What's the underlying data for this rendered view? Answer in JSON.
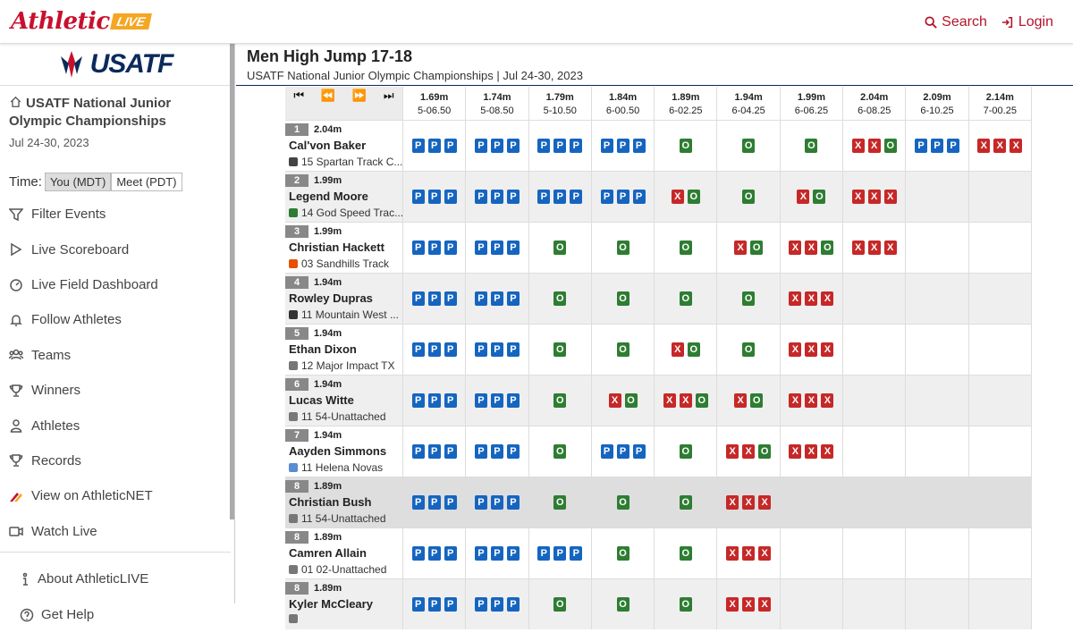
{
  "brand": {
    "logo_main": "Athletic",
    "logo_badge": "LIVE"
  },
  "topnav": {
    "search": "Search",
    "login": "Login"
  },
  "sidebar": {
    "org_logo": "USATF",
    "meet_title": "USATF National Junior Olympic Championships",
    "meet_dates": "Jul 24-30, 2023",
    "time_label": "Time:",
    "time_you": "You (MDT)",
    "time_meet": "Meet (PDT)",
    "items": [
      {
        "label": "Filter Events",
        "icon": "filter-icon"
      },
      {
        "label": "Live Scoreboard",
        "icon": "play-icon"
      },
      {
        "label": "Live Field Dashboard",
        "icon": "gauge-icon"
      },
      {
        "label": "Follow Athletes",
        "icon": "bell-icon"
      },
      {
        "label": "Teams",
        "icon": "users-icon"
      },
      {
        "label": "Winners",
        "icon": "trophy-icon"
      },
      {
        "label": "Athletes",
        "icon": "user-icon"
      },
      {
        "label": "Records",
        "icon": "trophy-icon"
      },
      {
        "label": "View on AthleticNET",
        "icon": "athleticnet-icon"
      },
      {
        "label": "Watch Live",
        "icon": "video-icon"
      }
    ],
    "footer_items": [
      {
        "label": "About AthleticLIVE",
        "icon": "info-icon"
      },
      {
        "label": "Get Help",
        "icon": "help-icon"
      }
    ]
  },
  "event": {
    "title": "Men High Jump 17-18",
    "subtitle": "USATF National Junior Olympic Championships | Jul 24-30, 2023"
  },
  "heights": [
    {
      "m": "1.69m",
      "ft": "5-06.50"
    },
    {
      "m": "1.74m",
      "ft": "5-08.50"
    },
    {
      "m": "1.79m",
      "ft": "5-10.50"
    },
    {
      "m": "1.84m",
      "ft": "6-00.50"
    },
    {
      "m": "1.89m",
      "ft": "6-02.25"
    },
    {
      "m": "1.94m",
      "ft": "6-04.25"
    },
    {
      "m": "1.99m",
      "ft": "6-06.25"
    },
    {
      "m": "2.04m",
      "ft": "6-08.25"
    },
    {
      "m": "2.09m",
      "ft": "6-10.25"
    },
    {
      "m": "2.14m",
      "ft": "7-00.25"
    }
  ],
  "athletes": [
    {
      "place": "1",
      "best": "2.04m",
      "name": "Cal'von Baker",
      "team": "15 Spartan Track C...",
      "team_color": "#444",
      "attempts": [
        "PPP",
        "PPP",
        "PPP",
        "PPP",
        "O",
        "O",
        "O",
        "XXO",
        "PPP",
        "XXX"
      ]
    },
    {
      "place": "2",
      "best": "1.99m",
      "name": "Legend Moore",
      "team": "14 God Speed Trac...",
      "team_color": "#2e7d32",
      "attempts": [
        "PPP",
        "PPP",
        "PPP",
        "PPP",
        "XO",
        "O",
        "XO",
        "XXX",
        "",
        ""
      ]
    },
    {
      "place": "3",
      "best": "1.99m",
      "name": "Christian Hackett",
      "team": "03 Sandhills Track",
      "team_color": "#e65100",
      "attempts": [
        "PPP",
        "PPP",
        "O",
        "O",
        "O",
        "XO",
        "XXO",
        "XXX",
        "",
        ""
      ]
    },
    {
      "place": "4",
      "best": "1.94m",
      "name": "Rowley Dupras",
      "team": "11 Mountain West ...",
      "team_color": "#333",
      "attempts": [
        "PPP",
        "PPP",
        "O",
        "O",
        "O",
        "O",
        "XXX",
        "",
        "",
        ""
      ]
    },
    {
      "place": "5",
      "best": "1.94m",
      "name": "Ethan Dixon",
      "team": "12 Major Impact TX",
      "team_color": "#777",
      "attempts": [
        "PPP",
        "PPP",
        "O",
        "O",
        "XO",
        "O",
        "XXX",
        "",
        "",
        ""
      ]
    },
    {
      "place": "6",
      "best": "1.94m",
      "name": "Lucas Witte",
      "team": "11 54-Unattached",
      "team_color": "#777",
      "attempts": [
        "PPP",
        "PPP",
        "O",
        "XO",
        "XXO",
        "XO",
        "XXX",
        "",
        "",
        ""
      ]
    },
    {
      "place": "7",
      "best": "1.94m",
      "name": "Aayden Simmons",
      "team": "11 Helena Novas",
      "team_color": "#5b8bd0",
      "attempts": [
        "PPP",
        "PPP",
        "O",
        "PPP",
        "O",
        "XXO",
        "XXX",
        "",
        "",
        ""
      ]
    },
    {
      "place": "8",
      "best": "1.89m",
      "name": "Christian Bush",
      "team": "11 54-Unattached",
      "team_color": "#777",
      "attempts": [
        "PPP",
        "PPP",
        "O",
        "O",
        "O",
        "XXX",
        "",
        "",
        "",
        ""
      ]
    },
    {
      "place": "8",
      "best": "1.89m",
      "name": "Camren Allain",
      "team": "01 02-Unattached",
      "team_color": "#777",
      "attempts": [
        "PPP",
        "PPP",
        "PPP",
        "O",
        "O",
        "XXX",
        "",
        "",
        "",
        ""
      ]
    },
    {
      "place": "8",
      "best": "1.89m",
      "name": "Kyler McCleary",
      "team": "",
      "team_color": "#777",
      "attempts": [
        "PPP",
        "PPP",
        "O",
        "O",
        "O",
        "XXX",
        "",
        "",
        "",
        ""
      ]
    }
  ]
}
